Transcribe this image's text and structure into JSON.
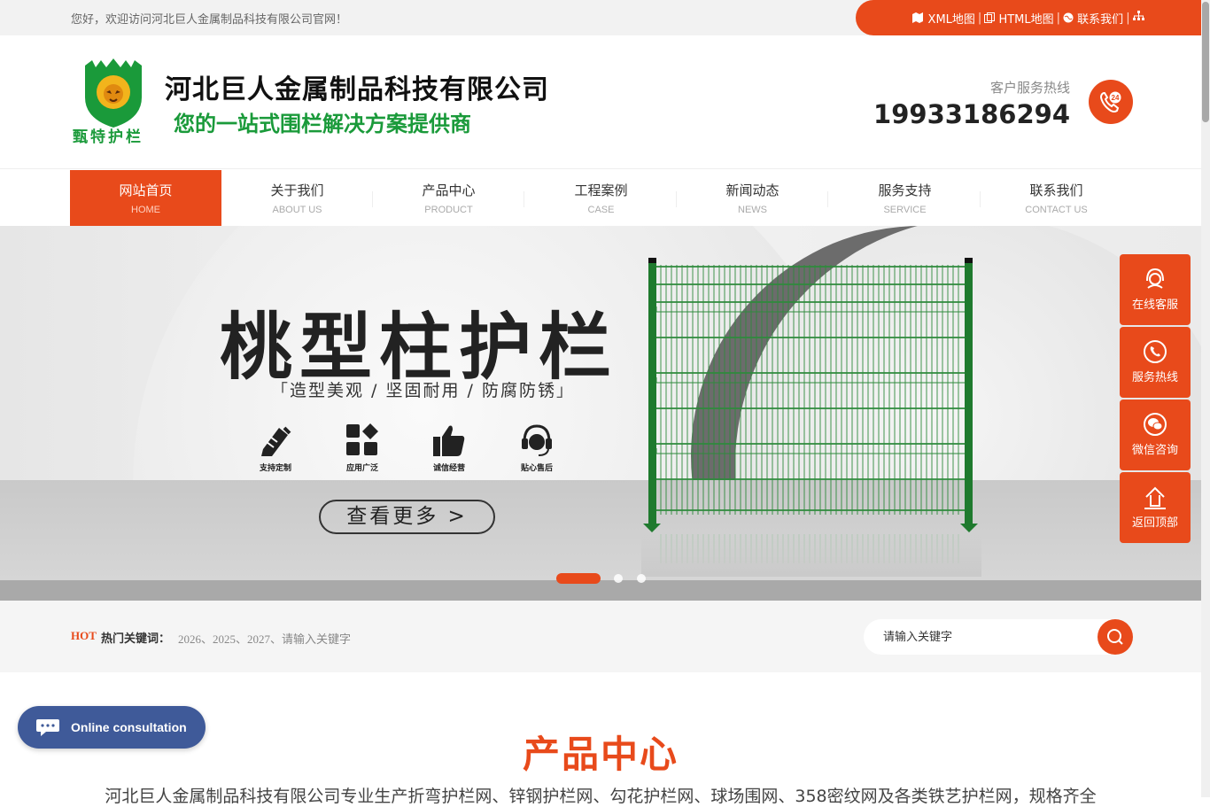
{
  "topbar": {
    "welcome": "您好，欢迎访问河北巨人金属制品科技有限公司官网！",
    "links": [
      {
        "icon": "map-icon",
        "label": "XML地图"
      },
      {
        "icon": "copy-icon",
        "label": "HTML地图"
      },
      {
        "icon": "globe-icon",
        "label": "联系我们"
      },
      {
        "icon": "sitemap-icon",
        "label": ""
      }
    ]
  },
  "header": {
    "logo_text": "甄特护栏",
    "company_name": "河北巨人金属制品科技有限公司",
    "slogan": "您的一站式围栏解决方案提供商",
    "hotline_label": "客户服务热线",
    "hotline_number": "19933186294",
    "hotline_icon": "phone-24-icon"
  },
  "nav": {
    "items": [
      {
        "cn": "网站首页",
        "en": "HOME",
        "active": true
      },
      {
        "cn": "关于我们",
        "en": "ABOUT US",
        "active": false
      },
      {
        "cn": "产品中心",
        "en": "PRODUCT",
        "active": false
      },
      {
        "cn": "工程案例",
        "en": "CASE",
        "active": false
      },
      {
        "cn": "新闻动态",
        "en": "NEWS",
        "active": false
      },
      {
        "cn": "服务支持",
        "en": "SERVICE",
        "active": false
      },
      {
        "cn": "联系我们",
        "en": "CONTACT US",
        "active": false
      }
    ]
  },
  "banner": {
    "title": "桃型柱护栏",
    "subtitle": "造型美观 / 坚固耐用 / 防腐防锈",
    "features": [
      {
        "icon": "pencil-ruler-icon",
        "label": "支持定制"
      },
      {
        "icon": "apps-grid-icon",
        "label": "应用广泛"
      },
      {
        "icon": "thumbs-up-icon",
        "label": "诚信经营"
      },
      {
        "icon": "headset-icon",
        "label": "贴心售后"
      }
    ],
    "more_button": "查看更多 >",
    "slides": {
      "count": 3,
      "active": 1
    }
  },
  "keywords": {
    "hot": "HOT",
    "label": "热门关键词：",
    "items": "2026、2025、2027、请输入关键字",
    "search_placeholder": "请输入关键字",
    "search_icon": "search-icon"
  },
  "product_center": {
    "title": "产品中心",
    "description": "河北巨人金属制品科技有限公司专业生产折弯护栏网、锌钢护栏网、勾花护栏网、球场围网、358密纹网及各类铁艺护栏网，规格齐全"
  },
  "float_bar": [
    {
      "icon": "customer-service-icon",
      "label": "在线客服"
    },
    {
      "icon": "phone-icon",
      "label": "服务热线"
    },
    {
      "icon": "wechat-icon",
      "label": "微信咨询"
    },
    {
      "icon": "arrow-up-icon",
      "label": "返回顶部"
    }
  ],
  "consult": {
    "label": "Online consultation",
    "icon": "chat-bubble-icon"
  },
  "colors": {
    "accent": "#e84a1b",
    "green": "#1a9a3a",
    "consult_blue": "#3f5a99"
  }
}
